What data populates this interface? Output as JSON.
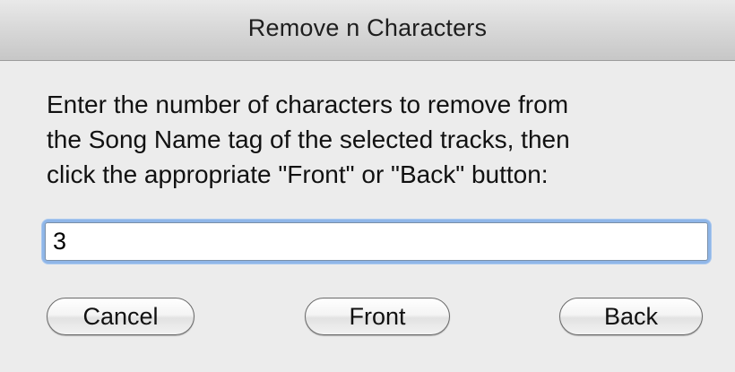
{
  "dialog": {
    "title": "Remove n Characters",
    "message": "Enter the number of characters to remove from\nthe Song Name tag of the selected tracks, then\nclick the appropriate \"Front\" or \"Back\" button:",
    "input_value": "3",
    "buttons": {
      "cancel_label": "Cancel",
      "front_label": "Front",
      "back_label": "Back"
    }
  }
}
